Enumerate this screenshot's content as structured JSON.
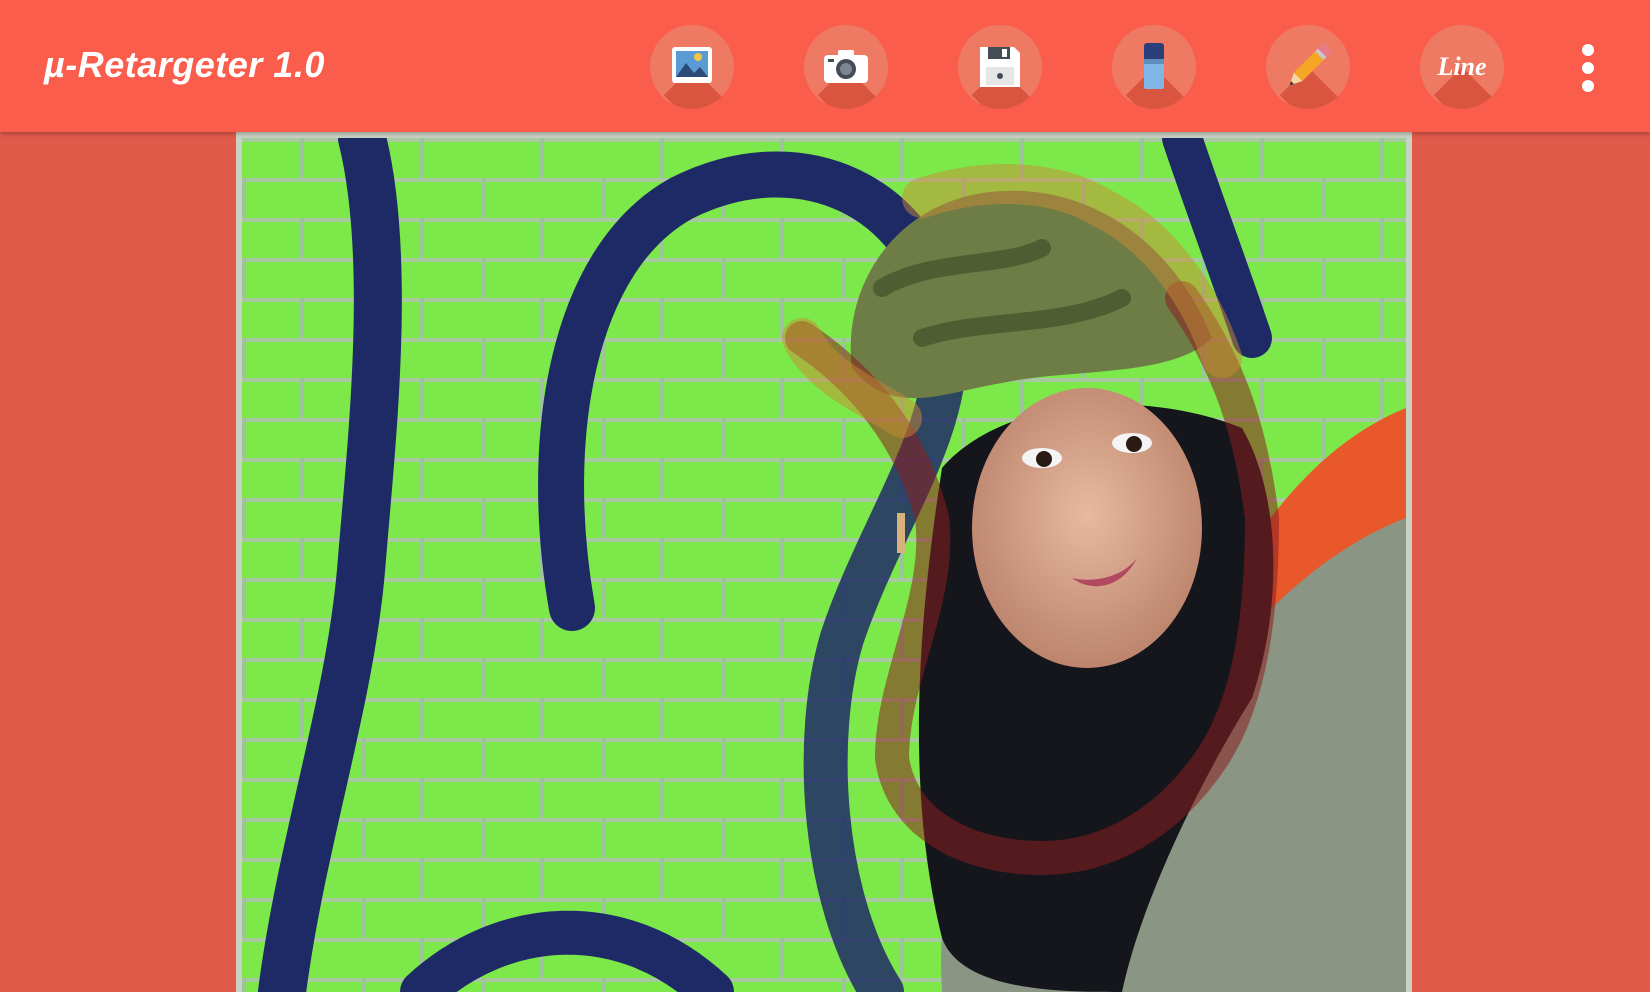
{
  "app": {
    "title": "µ-Retargeter 1.0"
  },
  "toolbar": {
    "tools": [
      {
        "id": "gallery",
        "icon": "image-gallery-icon"
      },
      {
        "id": "camera",
        "icon": "camera-icon"
      },
      {
        "id": "save",
        "icon": "floppy-disk-save-icon"
      },
      {
        "id": "eraser",
        "icon": "eraser-icon"
      },
      {
        "id": "pencil",
        "icon": "pencil-icon"
      },
      {
        "id": "line",
        "icon": "line-mode-icon",
        "label": "Line"
      }
    ],
    "overflow_icon": "more-vert-icon"
  },
  "colors": {
    "appbar": "#fa5d4b",
    "background": "#e05a4a",
    "tool_circle": "#ef7a63",
    "brick_green": "#7de84a",
    "graffiti_navy": "#1e2a66",
    "stroke_red": "#8b1f1f"
  }
}
